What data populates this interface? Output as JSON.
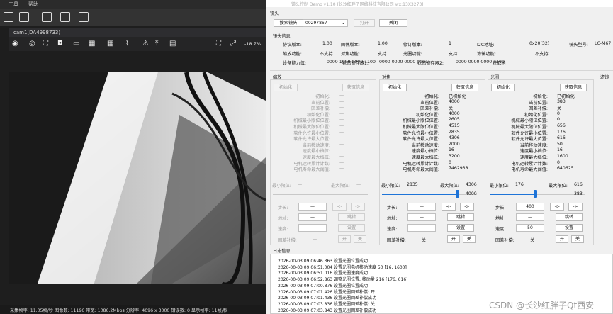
{
  "menu": {
    "tools": "工具",
    "help": "帮助"
  },
  "camera": {
    "title": "cam1(DA4998733)",
    "zoom": "-18.7%",
    "status": "采集帧率: 11.05帧/秒 图像数: 11196 带宽: 1086.2Mbps 分辨率: 4096 x 3000 错误数: 0 显示帧率: 11帧/秒"
  },
  "app": {
    "window_title": "镜头控制 Demo v1.10 (长沙红胖子网络科技有限公司 wx:13X3273) ",
    "lens_group": "镜头",
    "search_button": "搜索镜头",
    "lens_id": "00297867",
    "open_button": "打开",
    "close_button": "关闭",
    "info_group": "镜头信息",
    "info_rows": [
      [
        {
          "k": "协议版本:",
          "v": "1.00"
        },
        {
          "k": "固件版本:",
          "v": "1.00"
        },
        {
          "k": "修订版本:",
          "v": "1"
        },
        {
          "k": "I2C地址:",
          "v": "0x20(32)"
        },
        {
          "k": "镜头型号:",
          "v": "LC-M67"
        }
      ],
      [
        {
          "k": "缩放功能:",
          "v": "不支持"
        },
        {
          "k": "对焦功能:",
          "v": "支持"
        },
        {
          "k": "光圈功能:",
          "v": "支持"
        },
        {
          "k": "滤镜功能:",
          "v": "不支持"
        }
      ],
      [
        {
          "k": "设备能力位:",
          "v": "0000 1000 0000 1100"
        },
        {
          "k": "状态寄存器1:",
          "v": "0000 0000 0000 0001"
        },
        {
          "k": "状态寄存器2:",
          "v": "0000 0000 0000 1100"
        },
        {
          "k": "获取函"
        }
      ]
    ],
    "panels": [
      {
        "name": "缩放",
        "init_button": "初始化",
        "info_button": "获取信息",
        "enabled": false,
        "fields": [
          {
            "k": "初始化:",
            "v": "—"
          },
          {
            "k": "当前位置:",
            "v": "—"
          },
          {
            "k": "回差补偿:",
            "v": "—"
          },
          {
            "k": "初始化位置:",
            "v": "—"
          },
          {
            "k": "机械最小限位位置:",
            "v": "—"
          },
          {
            "k": "机械最大限位位置:",
            "v": "—"
          },
          {
            "k": "软件允许最小位置:",
            "v": "—"
          },
          {
            "k": "软件允许最大位置:",
            "v": "—"
          },
          {
            "k": "当前移动速度:",
            "v": "—"
          },
          {
            "k": "速度最小档位:",
            "v": "—"
          },
          {
            "k": "速度最大档位:",
            "v": "—"
          },
          {
            "k": "电机运转累计计数:",
            "v": "—"
          },
          {
            "k": "电机寿命最大阈值:",
            "v": "—"
          }
        ],
        "min_label": "最小限位:",
        "min_value": "—",
        "max_label": "最大限位:",
        "max_value": "—",
        "slider_value": "",
        "slider_fraction": 0,
        "step_label": "步长:",
        "step_value": "—",
        "step_dec": "<-",
        "step_inc": "->",
        "addr_label": "地址:",
        "addr_value": "—",
        "jump_button": "跳转",
        "speed_label": "速度:",
        "speed_value": "—",
        "set_button": "设置",
        "backlash_label": "回差补偿:",
        "backlash_value": "—",
        "on_button": "开",
        "off_button": "关"
      },
      {
        "name": "对焦",
        "init_button": "初始化",
        "info_button": "获取信息",
        "enabled": true,
        "fields": [
          {
            "k": "初始化:",
            "v": "已初始化"
          },
          {
            "k": "当前位置:",
            "v": "4000"
          },
          {
            "k": "回差补偿:",
            "v": "关"
          },
          {
            "k": "初始化位置:",
            "v": "4000"
          },
          {
            "k": "机械最小限位位置:",
            "v": "2605"
          },
          {
            "k": "机械最大限位位置:",
            "v": "4515"
          },
          {
            "k": "软件允许最小位置:",
            "v": "2835"
          },
          {
            "k": "软件允许最大位置:",
            "v": "4306"
          },
          {
            "k": "当前移动速度:",
            "v": "2000"
          },
          {
            "k": "速度最小档位:",
            "v": "16"
          },
          {
            "k": "速度最大档位:",
            "v": "3200"
          },
          {
            "k": "电机运转累计计数:",
            "v": "0"
          },
          {
            "k": "电机寿命最大阈值:",
            "v": "7462938"
          }
        ],
        "min_label": "最小限位:",
        "min_value": "2835",
        "max_label": "最大限位:",
        "max_value": "4306",
        "slider_value": "4000",
        "slider_fraction": 0.79,
        "step_label": "步长:",
        "step_value": "—",
        "step_dec": "<-",
        "step_inc": "->",
        "addr_label": "地址:",
        "addr_value": "—",
        "jump_button": "跳转",
        "speed_label": "速度:",
        "speed_value": "—",
        "set_button": "设置",
        "backlash_label": "回差补偿:",
        "backlash_value": "关",
        "on_button": "开",
        "off_button": "关"
      },
      {
        "name": "光圈",
        "init_button": "初始化",
        "info_button": "获取信息",
        "enabled": true,
        "fields": [
          {
            "k": "初始化:",
            "v": "已初始化"
          },
          {
            "k": "当前位置:",
            "v": "383"
          },
          {
            "k": "回差补偿:",
            "v": "关"
          },
          {
            "k": "初始化位置:",
            "v": "0"
          },
          {
            "k": "机械最小限位位置:",
            "v": "0"
          },
          {
            "k": "机械最大限位位置:",
            "v": "656"
          },
          {
            "k": "软件允许最小位置:",
            "v": "176"
          },
          {
            "k": "软件允许最大位置:",
            "v": "616"
          },
          {
            "k": "当前移动速度:",
            "v": "50"
          },
          {
            "k": "速度最小档位:",
            "v": "16"
          },
          {
            "k": "速度最大档位:",
            "v": "1600"
          },
          {
            "k": "电机运转累计计数:",
            "v": "0"
          },
          {
            "k": "电机寿命最大阈值:",
            "v": "640625"
          }
        ],
        "min_label": "最小限位:",
        "min_value": "176",
        "max_label": "最大限位:",
        "max_value": "616",
        "slider_value": "383",
        "slider_fraction": 0.47,
        "step_label": "步长:",
        "step_value": "400",
        "step_dec": "<-",
        "step_inc": "->",
        "addr_label": "地址:",
        "addr_value": "—",
        "jump_button": "跳转",
        "speed_label": "速度:",
        "speed_value": "50",
        "set_button": "设置",
        "backlash_label": "回差补偿:",
        "backlash_value": "关",
        "on_button": "开",
        "off_button": "关"
      }
    ],
    "filter_group_name": "滤镜",
    "log_group": "日志信息",
    "log": [
      "2026-00-03 09:06:46.363  设置光圈位置成功",
      "2026-00-03 09:06:51.004  设置光圈电机移动速度 50 [16, 1600]",
      "2026-00-03 09:06:51.016  设置光圈速度成功",
      "2026-00-03 09:06:52.863  调整光圈位置, 移动量 216 [176, 616]",
      "2026-00-03 09:07:00.876  设置光圈位置成功",
      "2026-00-03 09:07:01.426  设置光圈回差补偿: 开",
      "2026-00-03 09:07:01.436  设置光圈回差补偿成功",
      "2026-00-03 09:07:03.836  设置光圈回差补偿: 关",
      "2026-00-03 09:07:03.843  设置光圈回差补偿成功"
    ],
    "watermark": "CSDN @长沙红胖子Qt西安"
  }
}
